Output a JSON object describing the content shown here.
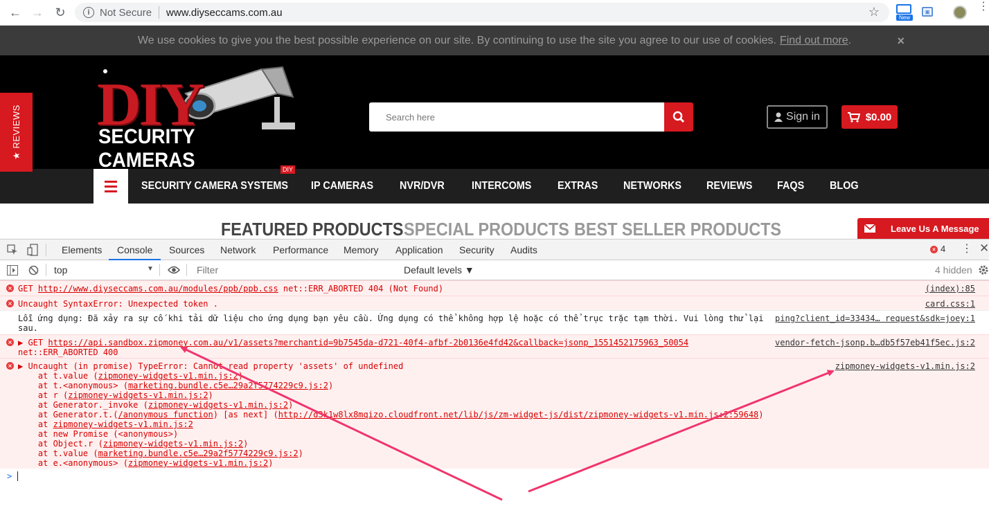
{
  "browser": {
    "security_label": "Not Secure",
    "url": "www.diyseccams.com.au",
    "ext_badge": "New"
  },
  "cookie_bar": {
    "text": "We use cookies to give you the best possible experience on our site. By continuing to use the site you agree to our use of cookies.",
    "link": "Find out more",
    "trail": ".",
    "close": "×"
  },
  "site": {
    "reviews_tab": "★ REVIEWS",
    "logo_top": "DIY",
    "logo_bottom": "SECURITY CAMERAS",
    "search_placeholder": "Search here",
    "signin": "Sign in",
    "cart_total": "$0.00",
    "nav": [
      "SECURITY CAMERA SYSTEMS",
      "IP CAMERAS",
      "NVR/DVR",
      "INTERCOMS",
      "EXTRAS",
      "NETWORKS",
      "REVIEWS",
      "FAQS",
      "BLOG"
    ],
    "nav_badge": "DIY",
    "product_tabs": [
      "FEATURED PRODUCTS",
      "SPECIAL PRODUCTS",
      "BEST SELLER PRODUCTS"
    ],
    "leave_message": "Leave Us A Message"
  },
  "devtools": {
    "tabs": [
      "Elements",
      "Console",
      "Sources",
      "Network",
      "Performance",
      "Memory",
      "Application",
      "Security",
      "Audits"
    ],
    "active_tab": "Console",
    "error_count": "4",
    "context": "top",
    "filter_placeholder": "Filter",
    "levels": "Default levels ▼",
    "hidden": "4 hidden"
  },
  "console": {
    "e1_pre": "GET ",
    "e1_url": "http://www.diyseccams.com.au/modules/ppb/ppb.css",
    "e1_post": " net::ERR_ABORTED 404 (Not Found)",
    "e1_src": "(index):85",
    "e2_text": "Uncaught SyntaxError: Unexpected token .",
    "e2_src": "card.css:1",
    "m3_text": "Lỗi ứng dụng: Đã xảy ra sự cố khi tải dữ liệu cho ứng dụng bạn yêu cầu. Ứng dụng có thể không hợp lệ hoặc có thể trục trặc tạm thời. Vui lòng thử lại",
    "m3_src": "ping?client_id=33434… request&sdk=joey:1",
    "m3_wrap": "sau.",
    "e4_pre": "▶ GET ",
    "e4_url": "https://api.sandbox.zipmoney.com.au/v1/assets?merchantid=9b7545da-d721-40f4-afbf-2b0136e4fd42&callback=jsonp_1551452175963_50054",
    "e4_src": "vendor-fetch-jsonp.b…db5f57eb41f5ec.js:2",
    "e4_line2": "net::ERR_ABORTED 400",
    "e5_head": "▶ Uncaught (in promise) TypeError: Cannot read property 'assets' of undefined",
    "e5_src": "zipmoney-widgets-v1.min.js:2",
    "stack": [
      {
        "pre": "    at t.value (",
        "link": "zipmoney-widgets-v1.min.js:2",
        "post": ")"
      },
      {
        "pre": "    at t.<anonymous> (",
        "link": "marketing.bundle.c5e…29a2f5774229c9.js:2",
        "post": ")"
      },
      {
        "pre": "    at r (",
        "link": "zipmoney-widgets-v1.min.js:2",
        "post": ")"
      },
      {
        "pre": "    at Generator._invoke (",
        "link": "zipmoney-widgets-v1.min.js:2",
        "post": ")"
      },
      {
        "pre": "    at Generator.t.(",
        "link": "/anonymous function",
        "post": ") [as next] (",
        "link2": "http://d3k1w8lx8mqizo.cloudfront.net/lib/js/zm-widget-js/dist/zipmoney-widgets-v1.min.js:2:59648",
        "post2": ")"
      },
      {
        "pre": "    at ",
        "link": "zipmoney-widgets-v1.min.js:2",
        "post": ""
      },
      {
        "pre": "    at new Promise (<anonymous>)",
        "link": "",
        "post": ""
      },
      {
        "pre": "    at Object.r (",
        "link": "zipmoney-widgets-v1.min.js:2",
        "post": ")"
      },
      {
        "pre": "    at t.value (",
        "link": "marketing.bundle.c5e…29a2f5774229c9.js:2",
        "post": ")"
      },
      {
        "pre": "    at e.<anonymous> (",
        "link": "zipmoney-widgets-v1.min.js:2",
        "post": ")"
      }
    ],
    "prompt": ">"
  },
  "colors": {
    "brand_red": "#d71920",
    "annotation_arrow": "#f0356b",
    "console_error": "#d80000"
  }
}
